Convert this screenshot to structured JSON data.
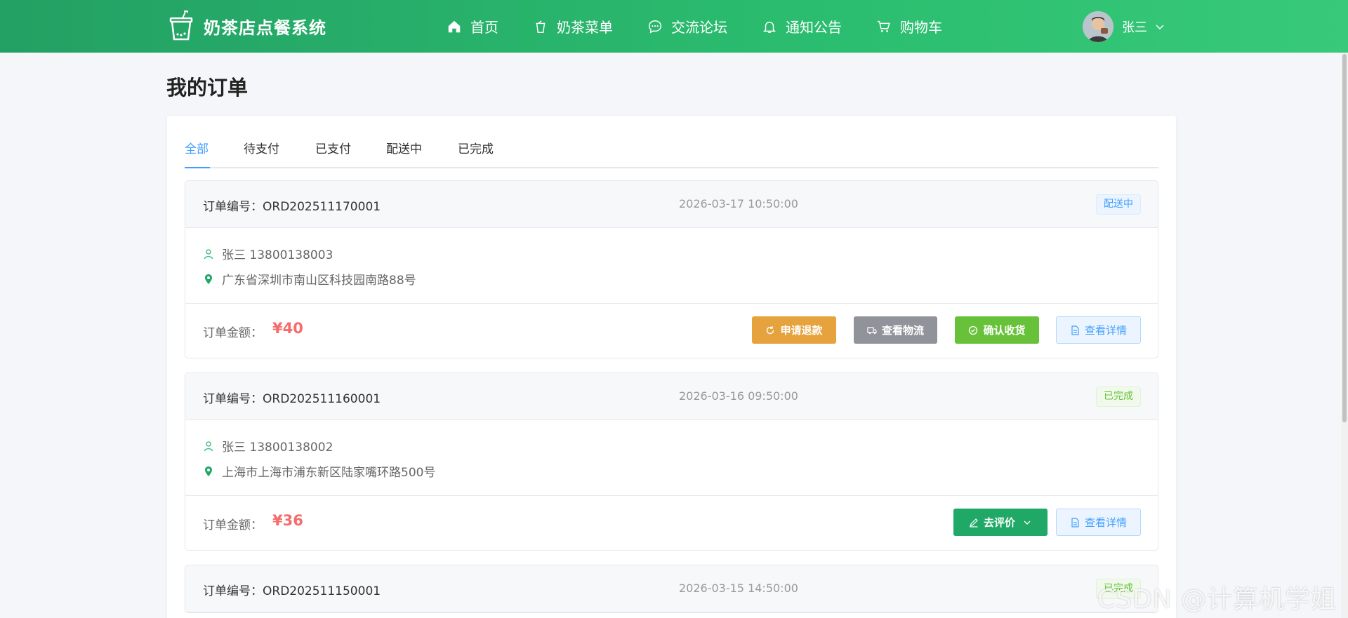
{
  "header": {
    "brand": "奶茶店点餐系统",
    "nav": [
      {
        "label": "首页",
        "icon": "home-icon"
      },
      {
        "label": "奶茶菜单",
        "icon": "cup-icon"
      },
      {
        "label": "交流论坛",
        "icon": "chat-icon"
      },
      {
        "label": "通知公告",
        "icon": "bell-icon"
      },
      {
        "label": "购物车",
        "icon": "cart-icon"
      }
    ],
    "user_name": "张三"
  },
  "page_title": "我的订单",
  "tabs": [
    "全部",
    "待支付",
    "已支付",
    "配送中",
    "已完成"
  ],
  "active_tab": "全部",
  "labels": {
    "order_no_prefix": "订单编号：",
    "amount_label": "订单金额："
  },
  "orders": [
    {
      "order_no": "订单编号：ORD202511170001",
      "time": "2026-03-17 10:50:00",
      "status": "配送中",
      "contact": "张三 13800138003",
      "address": "广东省深圳市南山区科技园南路88号",
      "amount": "¥40",
      "actions": [
        "申请退款",
        "查看物流",
        "确认收货",
        "查看详情"
      ]
    },
    {
      "order_no": "订单编号：ORD202511160001",
      "time": "2026-03-16 09:50:00",
      "status": "已完成",
      "contact": "张三 13800138002",
      "address": "上海市上海市浦东新区陆家嘴环路500号",
      "amount": "¥36",
      "actions": [
        "去评价",
        "查看详情"
      ]
    },
    {
      "order_no": "订单编号：ORD202511150001",
      "time": "2026-03-15 14:50:00",
      "status": "已完成"
    }
  ],
  "watermark": "CSDN @计算机学姐",
  "colors": {
    "header_green": "#2bbd6f",
    "active_blue": "#409eff",
    "price_red": "#f56c6c",
    "refund_orange": "#e6a23c",
    "logistics_gray": "#909399",
    "confirm_green": "#67c23a",
    "review_green": "#1fa866"
  }
}
